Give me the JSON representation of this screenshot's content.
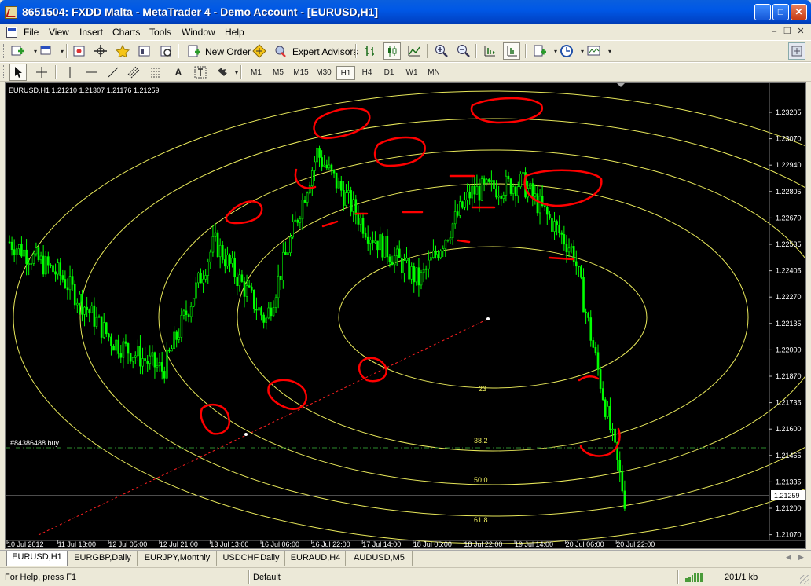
{
  "window": {
    "title": "8651504: FXDD Malta - MetaTrader 4 - Demo Account - [EURUSD,H1]",
    "minimize": "_",
    "maximize": "□",
    "close": "✕"
  },
  "menu": {
    "items": [
      "File",
      "View",
      "Insert",
      "Charts",
      "Tools",
      "Window",
      "Help"
    ],
    "mdi_minimize": "–",
    "mdi_restore": "❐",
    "mdi_close": "✕"
  },
  "toolbar": {
    "new_order_label": "New Order",
    "expert_advisors_label": "Expert Advisors",
    "timeframes": [
      "M1",
      "M5",
      "M15",
      "M30",
      "H1",
      "H4",
      "D1",
      "W1",
      "MN"
    ],
    "active_timeframe": "H1",
    "text_tool": "A"
  },
  "chart": {
    "info": "EURUSD,H1  1.21210 1.21307 1.21176 1.21259",
    "order_label": "#84386488 buy",
    "current_price_label": "1.21259",
    "price_axis": [
      "1.23205",
      "1.23070",
      "1.22940",
      "1.22805",
      "1.22670",
      "1.22535",
      "1.22405",
      "1.22270",
      "1.22135",
      "1.22000",
      "1.21870",
      "1.21735",
      "1.21600",
      "1.21465",
      "1.21335",
      "1.21200",
      "1.21070"
    ],
    "time_axis": [
      "10 Jul 2012",
      "11 Jul 13:00",
      "12 Jul 05:00",
      "12 Jul 21:00",
      "13 Jul 13:00",
      "16 Jul 06:00",
      "16 Jul 22:00",
      "17 Jul 14:00",
      "18 Jul 06:00",
      "18 Jul 22:00",
      "19 Jul 14:00",
      "20 Jul 06:00",
      "20 Jul 22:00"
    ],
    "fib_levels": [
      "23",
      "38.2",
      "50.0",
      "61.8"
    ],
    "colors": {
      "background": "#000000",
      "candles": "#00FF00",
      "fib_ellipses": "#E8E85A",
      "annotations": "#FF0000",
      "order_line": "#2E8B2E",
      "trend_line": "#FF2020"
    }
  },
  "chart_data": {
    "type": "line",
    "title": "EURUSD,H1",
    "xlabel": "",
    "ylabel": "",
    "ylim": [
      1.2107,
      1.2332
    ],
    "x": [
      "10 Jul 2012",
      "11 Jul 13:00",
      "12 Jul 05:00",
      "12 Jul 21:00",
      "13 Jul 13:00",
      "16 Jul 06:00",
      "16 Jul 22:00",
      "17 Jul 14:00",
      "18 Jul 06:00",
      "18 Jul 22:00",
      "19 Jul 14:00",
      "20 Jul 06:00",
      "20 Jul 22:00"
    ],
    "series": [
      {
        "name": "EURUSD,H1",
        "values": [
          1.2255,
          1.2238,
          1.2205,
          1.219,
          1.2255,
          1.2215,
          1.23,
          1.226,
          1.2235,
          1.228,
          1.2285,
          1.225,
          1.2125
        ]
      }
    ],
    "grid": false
  },
  "tabs": [
    "EURUSD,H1",
    "EURGBP,Daily",
    "EURJPY,Monthly",
    "USDCHF,Daily",
    "EURAUD,H4",
    "AUDUSD,M5"
  ],
  "active_tab": "EURUSD,H1",
  "status": {
    "help": "For Help, press F1",
    "profile": "Default",
    "traffic": "201/1 kb"
  }
}
